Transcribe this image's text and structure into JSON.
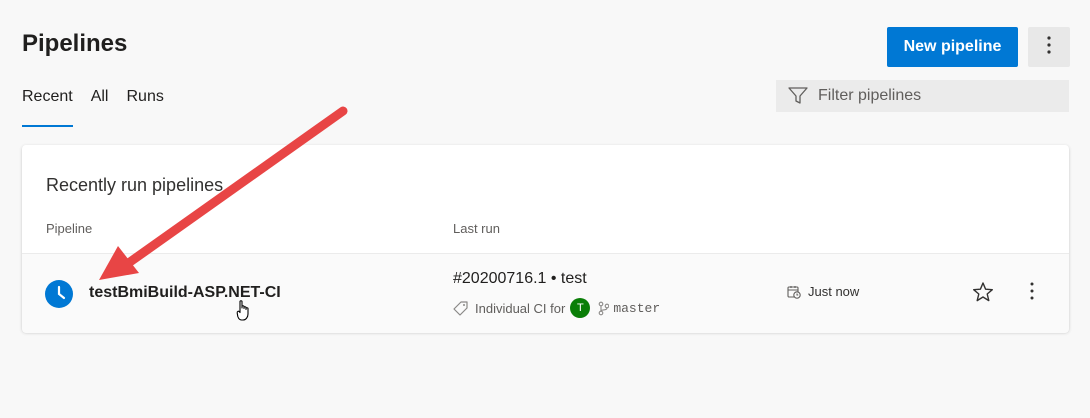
{
  "header": {
    "title": "Pipelines",
    "new_pipeline_label": "New pipeline",
    "more_icon": "more-vertical-icon"
  },
  "tabs": [
    {
      "label": "Recent",
      "active": true
    },
    {
      "label": "All",
      "active": false
    },
    {
      "label": "Runs",
      "active": false
    }
  ],
  "filter": {
    "placeholder": "Filter pipelines",
    "icon": "filter-icon"
  },
  "recent": {
    "title": "Recently run pipelines",
    "columns": {
      "pipeline": "Pipeline",
      "last_run": "Last run"
    },
    "rows": [
      {
        "status_icon": "clock-icon",
        "name": "testBmiBuild-ASP.NET-CI",
        "run_number": "#20200716.1 • test",
        "trigger_icon": "tag-icon",
        "trigger": "Individual CI for",
        "avatar_initial": "T",
        "branch_icon": "branch-icon",
        "branch": "master",
        "time_icon": "calendar-clock-icon",
        "time": "Just now",
        "favorite_icon": "star-icon",
        "more_icon": "more-vertical-icon"
      }
    ]
  },
  "colors": {
    "accent": "#0078d4",
    "avatar": "#0a7e07",
    "annotation_arrow": "#e84545"
  }
}
